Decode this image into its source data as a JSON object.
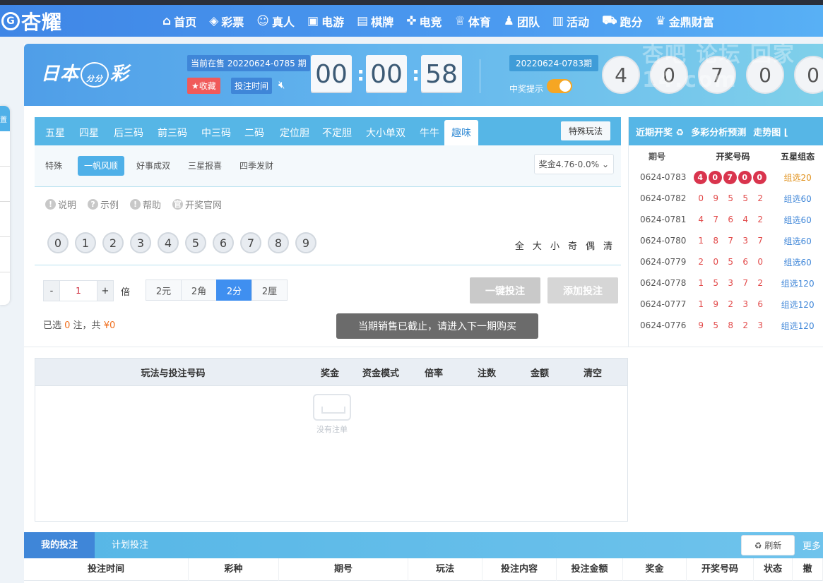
{
  "nav": {
    "logo": "杏耀",
    "items": [
      {
        "label": "首页",
        "icon": "home-icon",
        "glyph": "⌂"
      },
      {
        "label": "彩票",
        "icon": "ticket-icon",
        "glyph": "◈"
      },
      {
        "label": "真人",
        "icon": "person-icon",
        "glyph": "☺"
      },
      {
        "label": "电游",
        "icon": "slot-icon",
        "glyph": "▣"
      },
      {
        "label": "棋牌",
        "icon": "cards-icon",
        "glyph": "▤"
      },
      {
        "label": "电竞",
        "icon": "gamepad-icon",
        "glyph": "✜"
      },
      {
        "label": "体育",
        "icon": "trophy-icon",
        "glyph": "♕"
      },
      {
        "label": "团队",
        "icon": "team-icon",
        "glyph": "♟"
      },
      {
        "label": "活动",
        "icon": "gift-icon",
        "glyph": "▥"
      },
      {
        "label": "跑分",
        "icon": "car-icon",
        "glyph": "⛟"
      },
      {
        "label": "金鼎财富",
        "icon": "wealth-icon",
        "glyph": "♛"
      }
    ]
  },
  "header": {
    "game_name": "日本",
    "game_suffix": "彩",
    "game_badge": "分分min",
    "current_issue": "当前在售 20220624-0785 期",
    "fav_label": "★收藏",
    "bet_time_label": "投注时间",
    "mute_icon": "speaker-mute-icon",
    "countdown": [
      "00",
      "00",
      "58"
    ],
    "last_issue": "20220624-0783期",
    "win_tip_label": "中奖提示",
    "win_tip_on": true,
    "last_result": [
      "4",
      "0",
      "7",
      "0",
      "0"
    ],
    "watermark": "杏吧 论坛 回家14.com"
  },
  "play": {
    "tabs": [
      "五星",
      "四星",
      "后三码",
      "前三码",
      "中三码",
      "二码",
      "定位胆",
      "不定胆",
      "大小单双",
      "牛牛",
      "趣味"
    ],
    "active_tab": "趣味",
    "special_label": "特殊玩法",
    "subtabs": [
      "特殊",
      "一帆风顺",
      "好事成双",
      "三星报喜",
      "四季发财"
    ],
    "active_subtab": "一帆风顺",
    "bonus": "奖金4.76-0.0%",
    "helps": [
      {
        "label": "说明",
        "glyph": "!"
      },
      {
        "label": "示例",
        "glyph": "?"
      },
      {
        "label": "帮助",
        "glyph": "!"
      },
      {
        "label": "开奖官网",
        "glyph": "官"
      }
    ],
    "digits": [
      "0",
      "1",
      "2",
      "3",
      "4",
      "5",
      "6",
      "7",
      "8",
      "9"
    ],
    "quick": [
      "全",
      "大",
      "小",
      "奇",
      "偶",
      "清"
    ],
    "multiplier": "1",
    "bei_label": "倍",
    "units": [
      "2元",
      "2角",
      "2分",
      "2厘"
    ],
    "active_unit": "2分",
    "one_click_label": "一键投注",
    "add_label": "添加投注",
    "selected_prefix": "已选 ",
    "selected_count": "0",
    "selected_mid": " 注，共 ",
    "selected_amount": "¥0",
    "toast": "当期销售已截止，请进入下一期购买"
  },
  "recent": {
    "tabs": [
      "近期开奖 ♻",
      "多彩分析预测",
      "走势图 ⌊"
    ],
    "cols": [
      "期号",
      "开奖号码",
      "五星组态"
    ],
    "rows": [
      {
        "issue": "0624-0783",
        "nums": [
          "4",
          "0",
          "7",
          "0",
          "0"
        ],
        "type": "组选20",
        "hot": true
      },
      {
        "issue": "0624-0782",
        "nums": [
          "0",
          "9",
          "5",
          "5",
          "2"
        ],
        "type": "组选60"
      },
      {
        "issue": "0624-0781",
        "nums": [
          "4",
          "7",
          "6",
          "4",
          "2"
        ],
        "type": "组选60"
      },
      {
        "issue": "0624-0780",
        "nums": [
          "1",
          "8",
          "7",
          "3",
          "7"
        ],
        "type": "组选60"
      },
      {
        "issue": "0624-0779",
        "nums": [
          "2",
          "0",
          "5",
          "6",
          "0"
        ],
        "type": "组选60"
      },
      {
        "issue": "0624-0778",
        "nums": [
          "1",
          "5",
          "3",
          "7",
          "2"
        ],
        "type": "组选120"
      },
      {
        "issue": "0624-0777",
        "nums": [
          "1",
          "9",
          "2",
          "3",
          "6"
        ],
        "type": "组选120"
      },
      {
        "issue": "0624-0776",
        "nums": [
          "9",
          "5",
          "8",
          "2",
          "3"
        ],
        "type": "组选120"
      }
    ]
  },
  "orders": {
    "cols": [
      "玩法与投注号码",
      "奖金",
      "资金模式",
      "倍率",
      "注数",
      "金额",
      "清空"
    ],
    "empty_label": "没有注单"
  },
  "mybets": {
    "tabs": [
      "我的投注",
      "计划投注"
    ],
    "refresh_label": "♻ 刷新",
    "more_label": "更多",
    "cols": [
      "投注时间",
      "彩种",
      "期号",
      "玩法",
      "投注内容",
      "投注金额",
      "奖金",
      "开奖号码",
      "状态",
      "撤"
    ]
  },
  "leftbar": {
    "top_label": "置"
  }
}
